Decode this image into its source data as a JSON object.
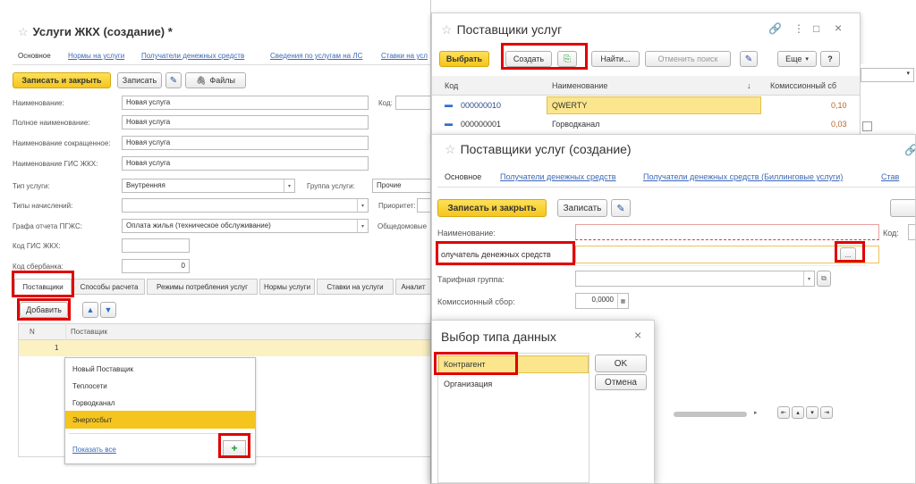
{
  "w1": {
    "title": "Услуги ЖКХ (создание) *",
    "tabs": [
      "Основное",
      "Нормы на услуги",
      "Получатели денежных средств",
      "Сведения по услугам на ЛС",
      "Ставки на усл"
    ],
    "save_close": "Записать и закрыть",
    "save": "Записать",
    "files": "Файлы",
    "fields": {
      "name_label": "Наименование:",
      "name_value": "Новая услуга",
      "code_label": "Код:",
      "full_label": "Полное наименование:",
      "full_value": "Новая услуга",
      "short_label": "Наименование сокращенное:",
      "short_value": "Новая услуга",
      "gis_label": "Наименование ГИС ЖКХ:",
      "gis_value": "Новая услуга",
      "type_label": "Тип услуги:",
      "type_value": "Внутренняя",
      "group_label": "Группа услуги:",
      "group_value": "Прочие",
      "acc_label": "Типы начислений:",
      "prio_label": "Приоритет:",
      "pgzhs_label": "Графа отчета ПГЖС:",
      "pgzhs_value": "Оплата жилья (техническое обслуживание)",
      "common_label": "Общедомовые",
      "giscode_label": "Код ГИС ЖКХ:",
      "sber_label": "Код сбербанка:",
      "sber_value": "0"
    },
    "ptabs": [
      "Поставщики",
      "Способы расчета",
      "Режимы потребления услуг",
      "Нормы услуги",
      "Ставки на услуги",
      "Аналит"
    ],
    "add": "Добавить",
    "table": {
      "col_n": "N",
      "col_supplier": "Поставщик",
      "row_n": "1"
    },
    "dropdown": {
      "items": [
        "Новый Поставщик",
        "Теплосети",
        "Горводканал",
        "Энергосбыт"
      ],
      "show_all": "Показать все"
    }
  },
  "w2": {
    "title": "Поставщики услуг",
    "select": "Выбрать",
    "create": "Создать",
    "find": "Найти...",
    "cancel_search": "Отменить поиск",
    "more": "Еще",
    "help": "?",
    "cols": [
      "Код",
      "Наименование",
      "Комиссионный сб"
    ],
    "rows": [
      {
        "code": "000000010",
        "name": "QWERTY",
        "fee": "0,10"
      },
      {
        "code": "000000001",
        "name": "Горводканал",
        "fee": "0,03"
      }
    ]
  },
  "w3": {
    "title": "Поставщики услуг (создание)",
    "tabs": [
      "Основное",
      "Получатели денежных средств",
      "Получатели денежных средств (Биллинговые услуги)",
      "Став"
    ],
    "save_close": "Записать и закрыть",
    "save": "Записать",
    "name_label": "Наименование:",
    "code_label": "Код:",
    "recipient_label": "олучатель денежных средств",
    "select_btn": "...",
    "tariff_label": "Тарифная группа:",
    "fee_label": "Комиссионный сбор:",
    "fee_value": "0,0000"
  },
  "w4": {
    "title": "Выбор типа данных",
    "close": "×",
    "items": [
      "Контрагент",
      "Организация"
    ],
    "ok": "OK",
    "cancel": "Отмена"
  },
  "colors": {
    "accent": "#f5c51d",
    "highlight": "#e00000",
    "link": "#3c68b8"
  }
}
